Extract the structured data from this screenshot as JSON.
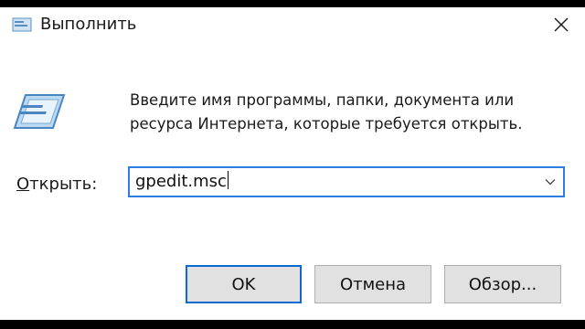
{
  "window": {
    "title": "Выполнить",
    "icon": "run-icon",
    "close_icon": "close-icon"
  },
  "description": "Введите имя программы, папки, документа или ресурса Интернета, которые требуется открыть.",
  "open_field": {
    "label": "Открыть:",
    "label_accel": "О",
    "label_rest": "ткрыть:",
    "value": "gpedit.msc"
  },
  "buttons": {
    "ok": "OK",
    "cancel": "Отмена",
    "browse": "Обзор..."
  },
  "colors": {
    "focus_border": "#2a7ee0",
    "ok_border": "#0a6ad3",
    "button_bg": "#e1e1e1"
  }
}
